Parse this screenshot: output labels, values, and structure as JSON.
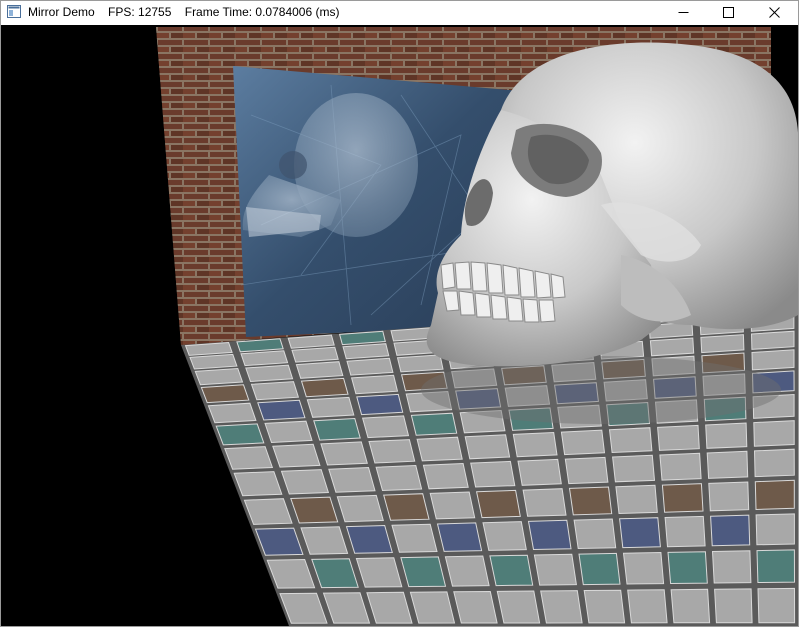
{
  "window": {
    "title": "Mirror Demo",
    "fps_label": "FPS: 12755",
    "frame_time_label": "Frame Time: 0.0784006 (ms)"
  },
  "controls": {
    "minimize_icon": "minimize-icon",
    "maximize_icon": "maximize-icon",
    "close_icon": "close-icon"
  },
  "scene": {
    "description_elements": [
      "brick-wall",
      "mirror",
      "skull",
      "skull-reflection",
      "tiled-floor"
    ],
    "colors": {
      "brick": "#6b3a2a",
      "mortar": "#8c7a6a",
      "mirror": "#3d5a78",
      "floor_gray": "#a8a8a8",
      "floor_teal": "#4f7d78",
      "floor_blue": "#4d5a80",
      "floor_brown": "#6e5a4a",
      "skull": "#cfcfcf"
    }
  }
}
